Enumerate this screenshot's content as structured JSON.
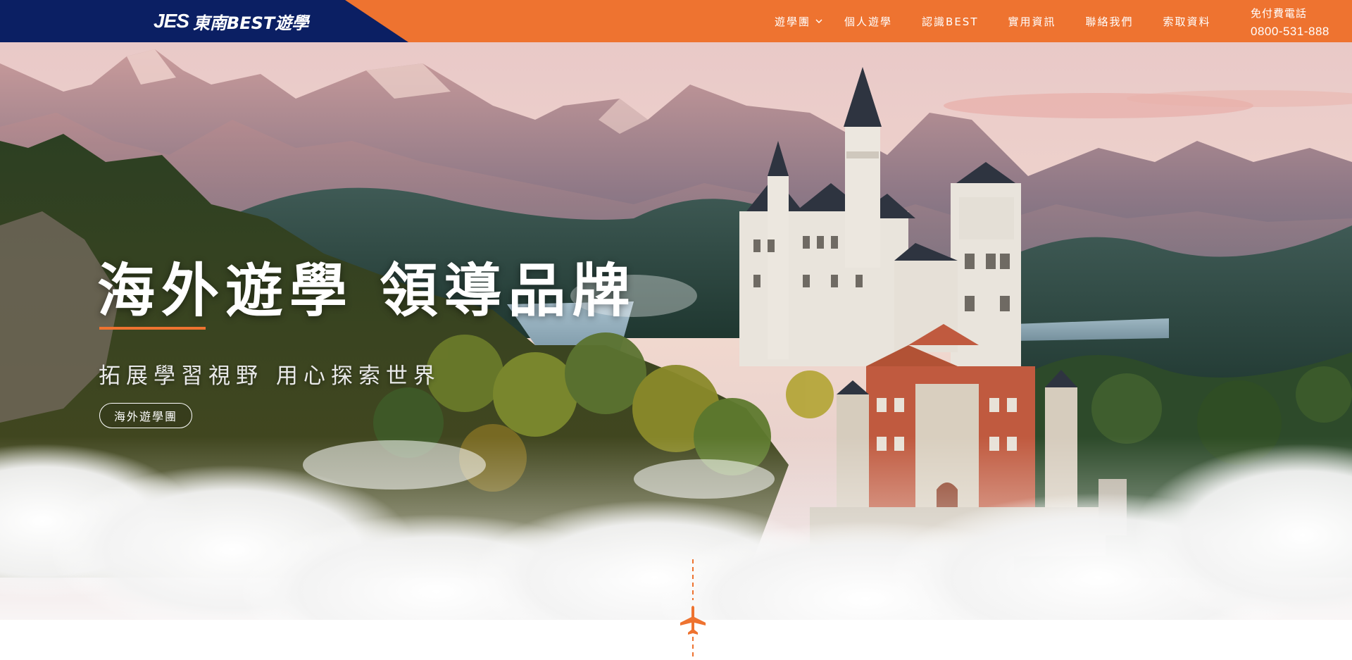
{
  "brand": {
    "logo_mark": "JES",
    "logo_text": "東南BEST遊學",
    "navy": "#0b1f63",
    "orange": "#ee7330"
  },
  "nav": {
    "items": [
      {
        "label": "遊學團",
        "dropdown": true
      },
      {
        "label": "個人遊學"
      },
      {
        "label": "認識BEST"
      },
      {
        "label": "實用資訊"
      },
      {
        "label": "聯絡我們"
      },
      {
        "label": "索取資料"
      }
    ],
    "phone_label": "免付費電話",
    "phone_number": "0800-531-888"
  },
  "hero": {
    "title": "海外遊學 領導品牌",
    "subtitle": "拓展學習視野 用心探索世界",
    "button_label": "海外遊學團"
  },
  "icons": {
    "scroll": "airplane-icon",
    "dropdown": "chevron-down-icon"
  }
}
